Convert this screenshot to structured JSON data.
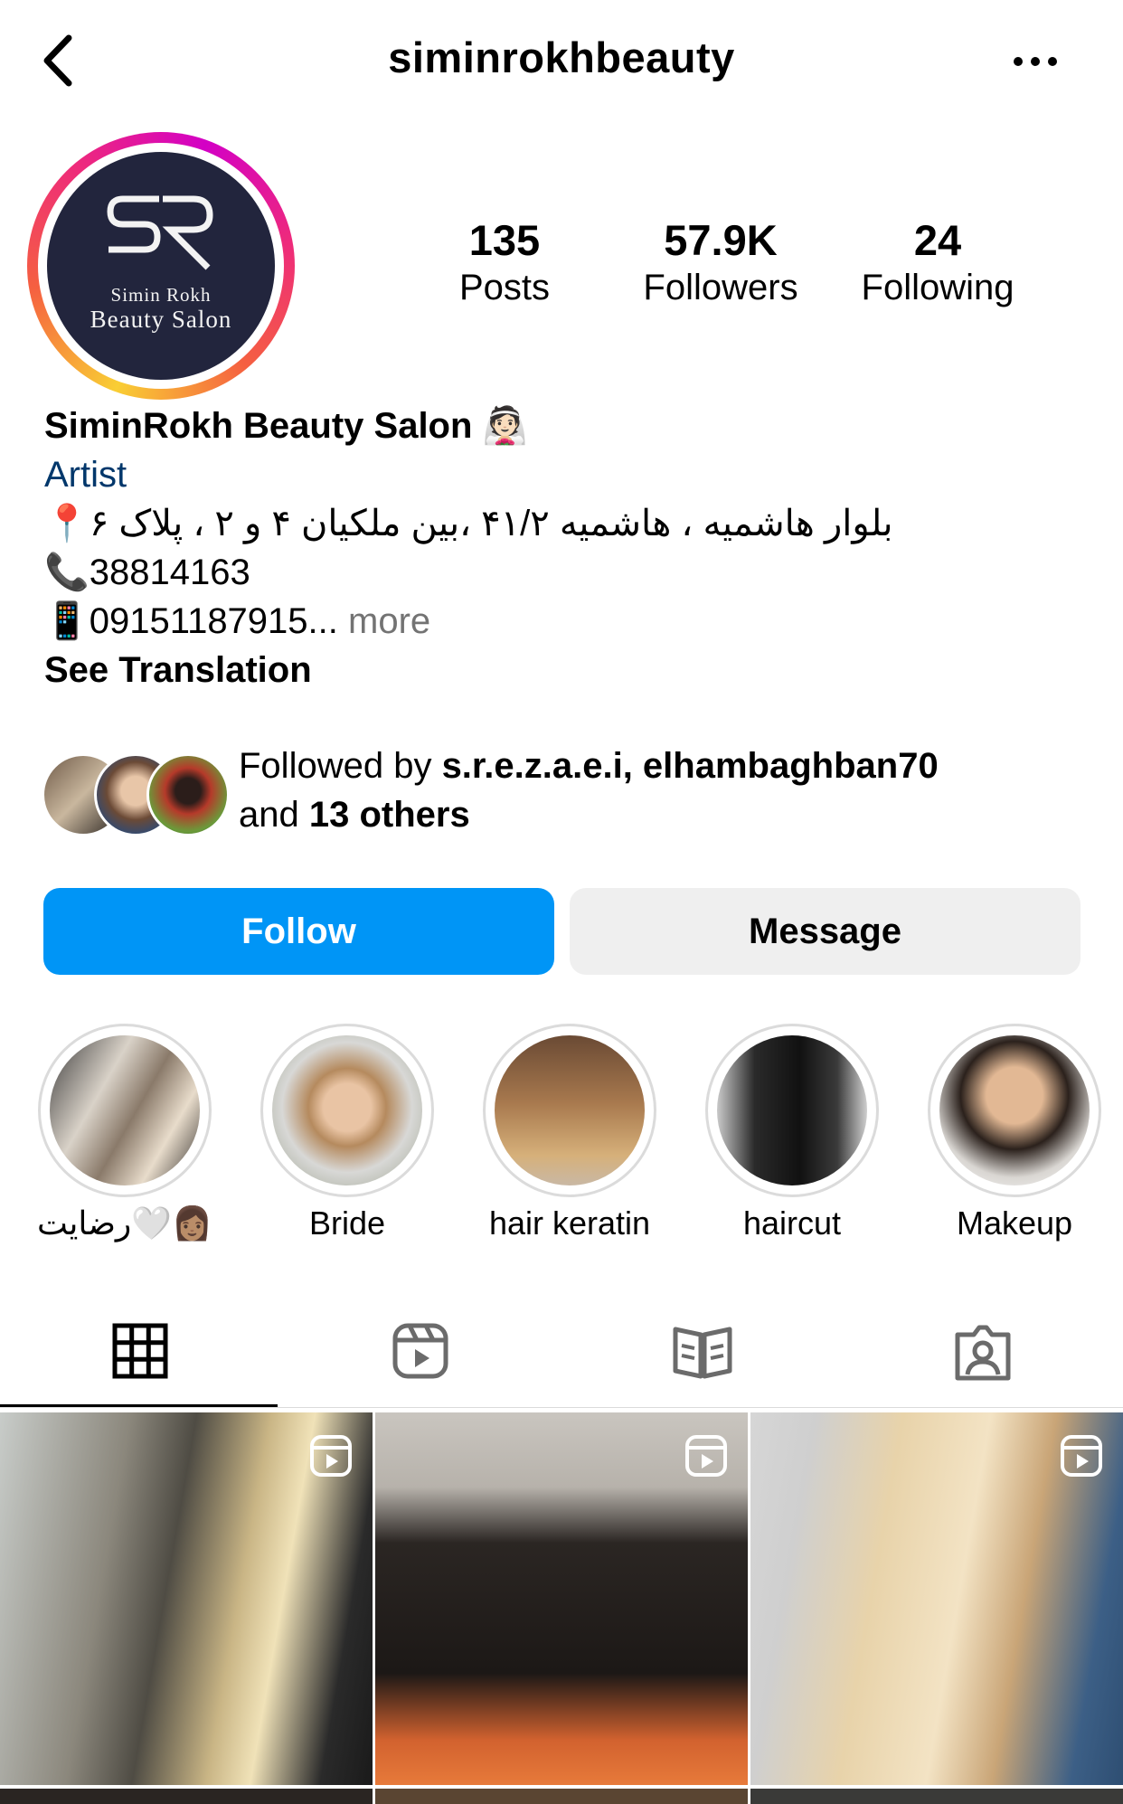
{
  "header": {
    "username": "siminrokhbeauty",
    "back_icon": "chevron-left-icon",
    "more_icon": "ellipsis-icon"
  },
  "avatar": {
    "logo_letters": "SR",
    "line1": "Simin Rokh",
    "line2": "Beauty Salon"
  },
  "stats": [
    {
      "value": "135",
      "label": "Posts"
    },
    {
      "value": "57.9K",
      "label": "Followers"
    },
    {
      "value": "24",
      "label": "Following"
    }
  ],
  "bio": {
    "name": "SiminRokh Beauty Salon 👰🏻",
    "category": "Artist",
    "address": "📍بلوار هاشمیه ، هاشمیه ۴۱/۲ ،بین ملکیان ۴ و ۲ ، پلاک ۶",
    "phone": "📞38814163",
    "mobile": "📱09151187915...",
    "more": " more",
    "see_translation": "See Translation"
  },
  "followed_by": {
    "prefix": "Followed by ",
    "users": "s.r.e.z.a.e.i, elhambaghban70",
    "and": "and ",
    "others": "13 others"
  },
  "actions": {
    "follow": "Follow",
    "message": "Message"
  },
  "highlights": [
    {
      "label": "رضایت🤍👩🏽"
    },
    {
      "label": "Bride"
    },
    {
      "label": "hair keratin"
    },
    {
      "label": "haircut"
    },
    {
      "label": "Makeup"
    }
  ],
  "tabs": [
    {
      "name": "grid",
      "icon": "grid-icon"
    },
    {
      "name": "reels",
      "icon": "reels-icon"
    },
    {
      "name": "guides",
      "icon": "guide-book-icon"
    },
    {
      "name": "tagged",
      "icon": "tagged-person-icon"
    }
  ],
  "colors": {
    "accent": "#0095f6",
    "category_link": "#00376b",
    "muted": "#737373",
    "avatar_bg": "#22253d"
  }
}
